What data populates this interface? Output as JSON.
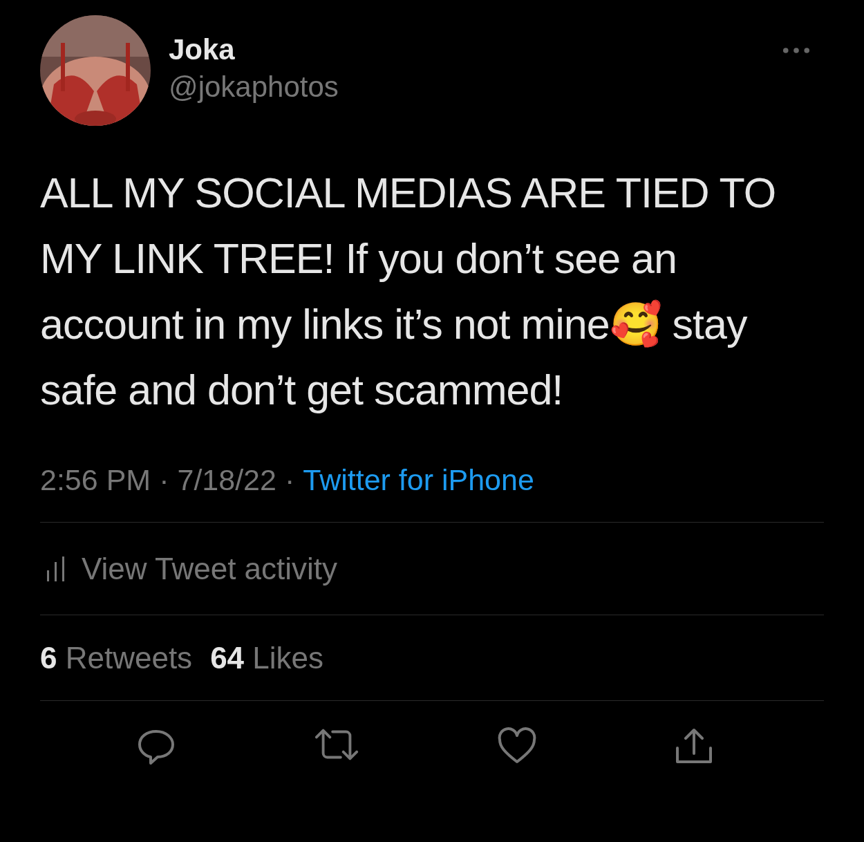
{
  "author": {
    "name": "Joka",
    "handle": "@jokaphotos"
  },
  "text": "ALL MY SOCIAL MEDIAS ARE TIED TO MY LINK TREE! If you don’t see an account in my links it’s not mine🥰 stay safe and don’t get scammed!",
  "meta": [
    {
      "kind": "time",
      "text": "2:56 PM"
    },
    {
      "kind": "separator",
      "text": "·"
    },
    {
      "kind": "date",
      "text": "7/18/22"
    },
    {
      "kind": "separator",
      "text": "·"
    },
    {
      "kind": "source",
      "text": "Twitter for iPhone"
    }
  ],
  "activity_link": "View Tweet activity",
  "stats": [
    "**6** Retweets",
    "**64** Likes"
  ],
  "actions": [
    {
      "kind": "reply"
    },
    {
      "kind": "retweet"
    },
    {
      "kind": "like"
    },
    {
      "kind": "share"
    }
  ]
}
